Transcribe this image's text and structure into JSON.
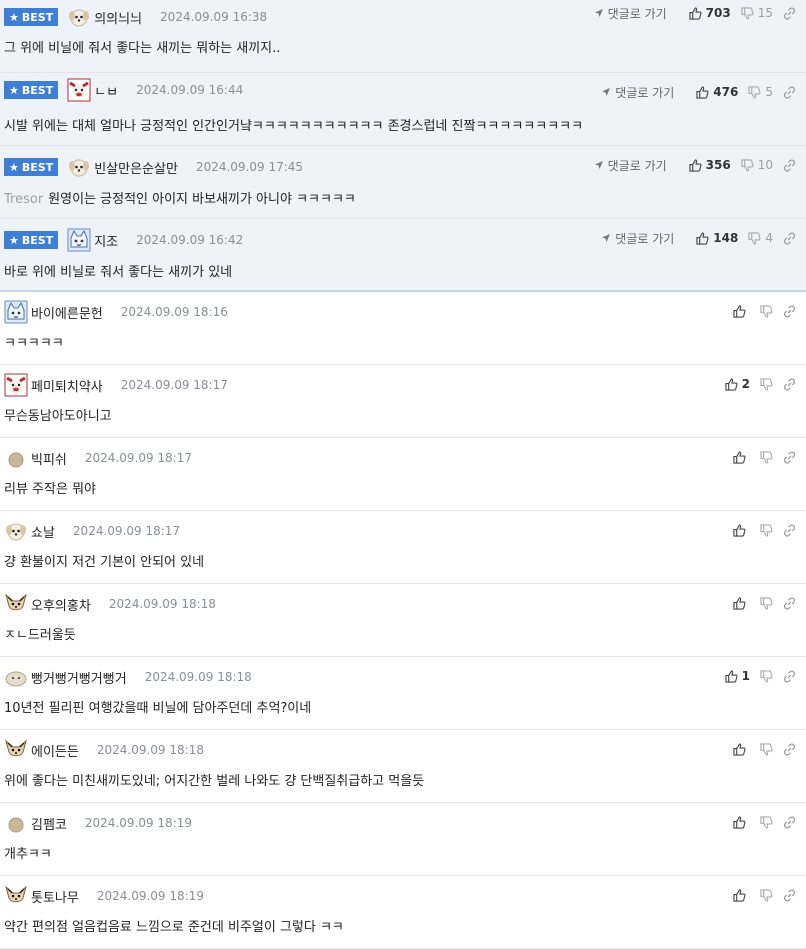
{
  "badge_label": "BEST",
  "reply_label": "댓글로 가기",
  "comments": [
    {
      "type": "best",
      "avatar": "dog-white",
      "nick": "의의늬늬",
      "date": "2024.09.09 16:38",
      "text": "그 위에 비닐에 줘서 좋다는 새끼는 뭐하는 새끼지..",
      "up": "703",
      "down": "15"
    },
    {
      "type": "best",
      "avatar": "clown",
      "nick": "ㄴㅂ",
      "date": "2024.09.09 16:44",
      "text": "시발 위에는 대체 얼마나 긍정적인 인간인거냨ㅋㅋㅋㅋㅋㅋㅋㅋㅋㅋㅋ 존경스럽네 진짴ㅋㅋㅋㅋㅋㅋㅋㅋㅋ",
      "up": "476",
      "down": "5"
    },
    {
      "type": "best",
      "avatar": "dog-white",
      "nick": "빈살만은순살만",
      "date": "2024.09.09 17:45",
      "prefix": "Tresor",
      "text": "원영이는 긍정적인 아이지 바보새끼가 아니야 ㅋㅋㅋㅋㅋ",
      "up": "356",
      "down": "10"
    },
    {
      "type": "best",
      "avatar": "cat-blue",
      "nick": "지조",
      "date": "2024.09.09 16:42",
      "text": "바로 위에 비닐로 줘서 좋다는 새끼가 있네",
      "up": "148",
      "down": "4"
    },
    {
      "type": "normal",
      "avatar": "cat-blue",
      "nick": "바이에른문헌",
      "date": "2024.09.09 18:16",
      "text": "ㅋㅋㅋㅋㅋ",
      "up": "",
      "down": ""
    },
    {
      "type": "normal",
      "avatar": "clown",
      "nick": "페미퇴치약사",
      "date": "2024.09.09 18:17",
      "text": "무슨동남아도아니고",
      "up": "2",
      "down": ""
    },
    {
      "type": "normal",
      "avatar": "dot",
      "nick": "빅피쉬",
      "date": "2024.09.09 18:17",
      "text": "리뷰 주작은 뭐야",
      "up": "",
      "down": ""
    },
    {
      "type": "normal",
      "avatar": "dog-white",
      "nick": "쇼날",
      "date": "2024.09.09 18:17",
      "text": "걍 환불이지 저건 기본이 안되어 있네",
      "up": "",
      "down": ""
    },
    {
      "type": "normal",
      "avatar": "chihuahua",
      "nick": "오후의홍차",
      "date": "2024.09.09 18:18",
      "text": "ㅈㄴ드러울듯",
      "up": "",
      "down": ""
    },
    {
      "type": "normal",
      "avatar": "blob",
      "nick": "뻥거뻥거뻥거뻥거",
      "date": "2024.09.09 18:18",
      "text": "10년전 필리핀 여행갔을때 비닐에 담아주던데 추억?이네",
      "up": "1",
      "down": ""
    },
    {
      "type": "normal",
      "avatar": "chihuahua",
      "nick": "에이든든",
      "date": "2024.09.09 18:18",
      "text": "위에 좋다는 미친새끼도있네; 어지간한 벌레 나와도 걍 단백질취급하고 먹을듯",
      "up": "",
      "down": ""
    },
    {
      "type": "normal",
      "avatar": "dot",
      "nick": "김펨코",
      "date": "2024.09.09 18:19",
      "text": "개추ㅋㅋ",
      "up": "",
      "down": ""
    },
    {
      "type": "normal",
      "avatar": "chihuahua",
      "nick": "톳토나무",
      "date": "2024.09.09 18:19",
      "text": "약간 편의점 얼음컵음료 느낌으로 준건데 비주얼이 그렇다 ㅋㅋ",
      "up": "",
      "down": ""
    }
  ]
}
